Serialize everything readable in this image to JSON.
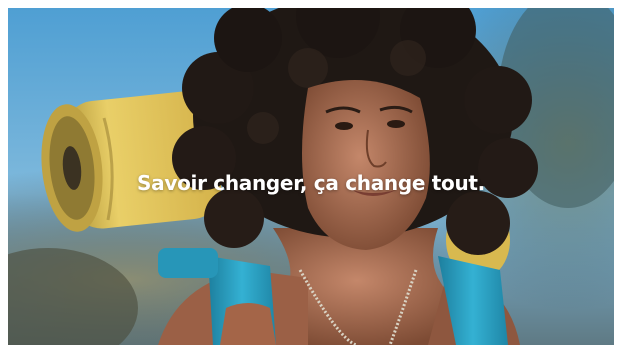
{
  "ad": {
    "tagline": "Savoir changer, ça change tout."
  },
  "colors": {
    "sky": "#5aa6d6",
    "yoga_mat": "#e7c75a",
    "backpack_strap": "#2ea6c9",
    "hair": "#1e1713",
    "skin": "#a86a4c",
    "tagline_text": "#ffffff"
  },
  "scene": {
    "subject": "woman-with-curly-hair",
    "props": [
      "rolled-yoga-mat",
      "teal-backpack",
      "beaded-necklace"
    ]
  }
}
